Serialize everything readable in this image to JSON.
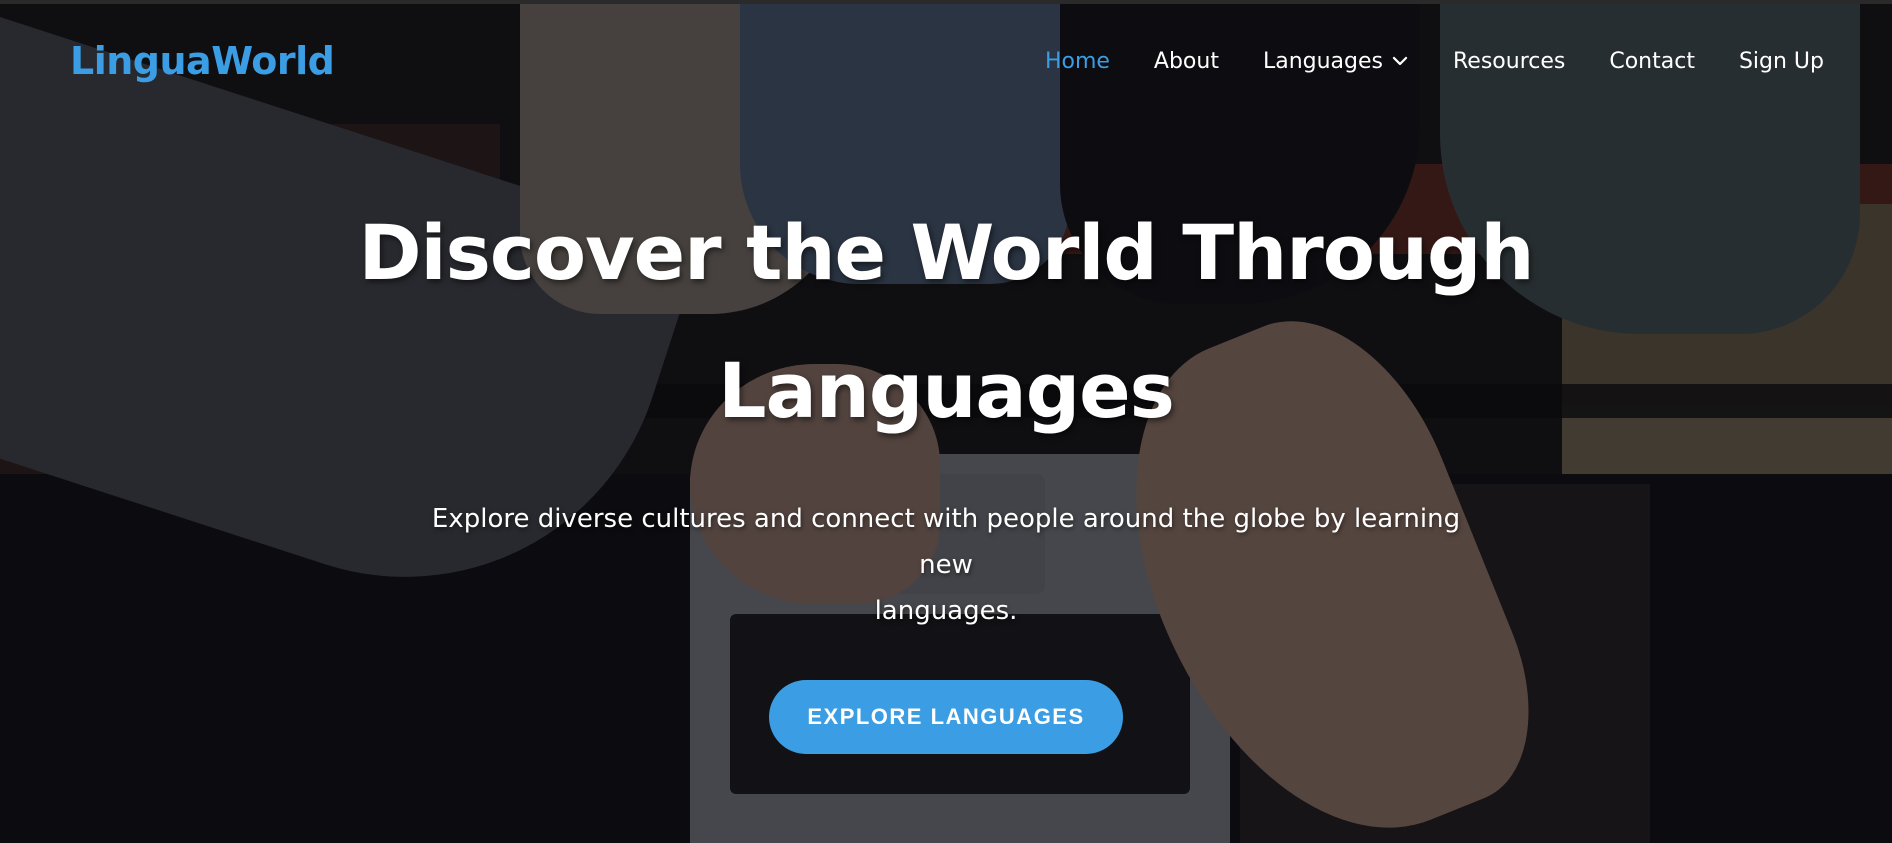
{
  "nav": {
    "logo": "LinguaWorld",
    "items": [
      {
        "label": "Home",
        "active": true
      },
      {
        "label": "About"
      },
      {
        "label": "Languages",
        "has_dropdown": true,
        "icon": "chevron-down-icon"
      },
      {
        "label": "Resources"
      },
      {
        "label": "Contact"
      },
      {
        "label": "Sign Up"
      }
    ]
  },
  "hero": {
    "headline_line1": "Discover the World Through",
    "headline_line2": "Languages",
    "subtitle_line1": "Explore diverse cultures and connect with people around the globe by learning new",
    "subtitle_line2": "languages.",
    "cta_label": "EXPLORE LANGUAGES"
  },
  "colors": {
    "accent": "#3b9de3",
    "text": "#ffffff",
    "overlay": "rgba(10,10,14,0.62)"
  }
}
